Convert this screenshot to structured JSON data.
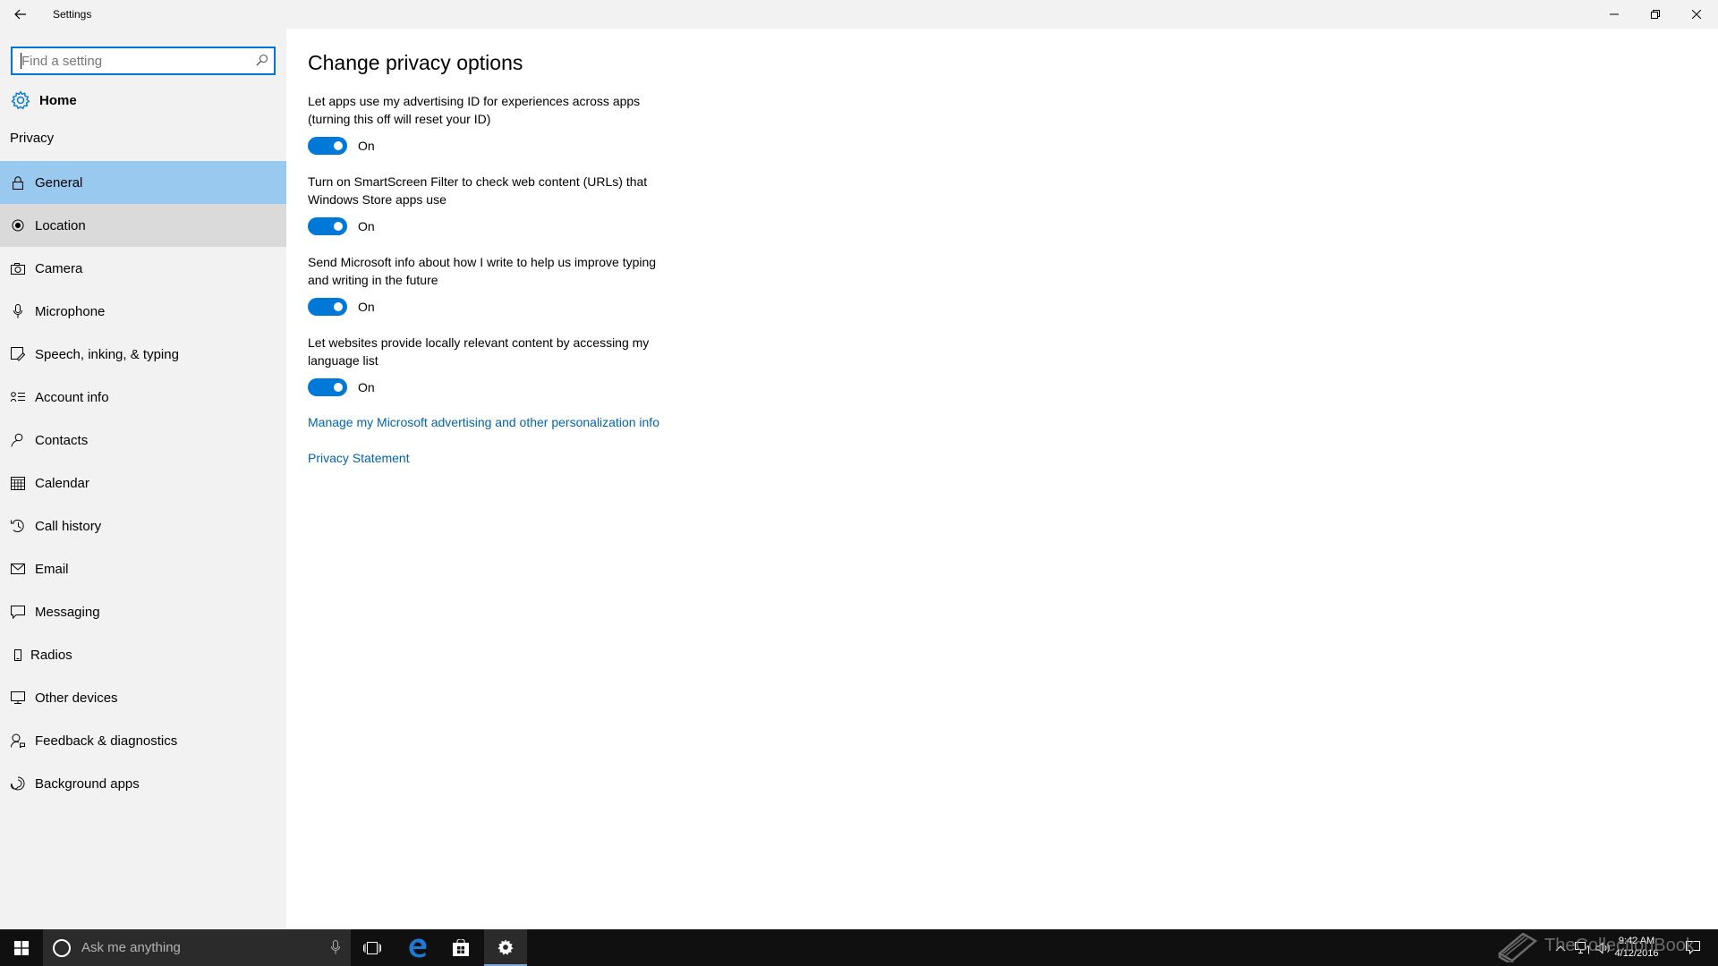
{
  "window": {
    "title": "Settings",
    "back_icon": "arrow-left-icon",
    "controls": [
      "minimize-icon",
      "restore-icon",
      "close-icon"
    ]
  },
  "sidebar": {
    "search_placeholder": "Find a setting",
    "home_label": "Home",
    "section_label": "Privacy",
    "items": [
      {
        "label": "General",
        "icon": "lock-icon",
        "state": "selected"
      },
      {
        "label": "Location",
        "icon": "location-icon",
        "state": "hover"
      },
      {
        "label": "Camera",
        "icon": "camera-icon",
        "state": ""
      },
      {
        "label": "Microphone",
        "icon": "microphone-icon",
        "state": ""
      },
      {
        "label": "Speech, inking, & typing",
        "icon": "speech-icon",
        "state": ""
      },
      {
        "label": "Account info",
        "icon": "account-info-icon",
        "state": ""
      },
      {
        "label": "Contacts",
        "icon": "contacts-icon",
        "state": ""
      },
      {
        "label": "Calendar",
        "icon": "calendar-icon",
        "state": ""
      },
      {
        "label": "Call history",
        "icon": "call-history-icon",
        "state": ""
      },
      {
        "label": "Email",
        "icon": "email-icon",
        "state": ""
      },
      {
        "label": "Messaging",
        "icon": "messaging-icon",
        "state": ""
      },
      {
        "label": "Radios",
        "icon": "radios-icon",
        "state": ""
      },
      {
        "label": "Other devices",
        "icon": "other-devices-icon",
        "state": ""
      },
      {
        "label": "Feedback & diagnostics",
        "icon": "feedback-icon",
        "state": ""
      },
      {
        "label": "Background apps",
        "icon": "background-apps-icon",
        "state": ""
      }
    ]
  },
  "main": {
    "title": "Change privacy options",
    "settings": [
      {
        "line1": "Let apps use my advertising ID for experiences across apps",
        "line2": "(turning this off will reset your ID)",
        "state": "On"
      },
      {
        "line1": "Turn on SmartScreen Filter to check web content (URLs) that",
        "line2": "Windows Store apps use",
        "state": "On"
      },
      {
        "line1": "Send Microsoft info about how I write to help us improve typing",
        "line2": "and writing in the future",
        "state": "On"
      },
      {
        "line1": "Let websites provide locally relevant content by accessing my",
        "line2": "language list",
        "state": "On"
      }
    ],
    "links": {
      "manage": "Manage my Microsoft advertising and other personalization info",
      "privacy": "Privacy Statement"
    }
  },
  "taskbar": {
    "search_placeholder": "Ask me anything",
    "time": "9:42 AM",
    "date": "4/12/2016",
    "accent_color": "#0078d7"
  },
  "watermark": "TheCollectionBook"
}
